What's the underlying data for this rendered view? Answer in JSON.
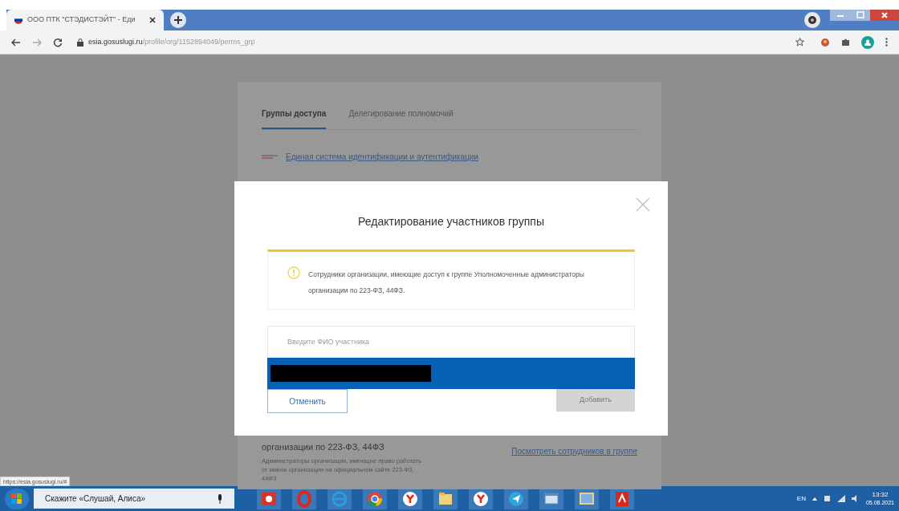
{
  "browser": {
    "tab_title": "ООО ПТК \"СТЭДИСТЭЙТ\" - Еди",
    "url_host": "esia.gosuslugi.ru",
    "url_path": "/profile/org/1152894049/perms_grp"
  },
  "page": {
    "tabs": [
      {
        "label": "Группы доступа",
        "selected": true
      },
      {
        "label": "Делегирование полномочий",
        "selected": false
      }
    ],
    "system_link": "Единая система идентификации и аутентификации",
    "group_title": "организации по 223-ФЗ, 44ФЗ",
    "group_description": "Администраторы организации, имеющие право работать от имени организации на официальном сайте 223-ФЗ, 44ФЗ",
    "view_link": "Посмотреть сотрудников в группе"
  },
  "modal": {
    "title": "Редактирование участников группы",
    "notice": "Сотрудники организации, имеющие доступ к группе Уполномоченные администраторы организации по 223-ФЗ, 44ФЗ.",
    "search": {
      "placeholder": "Введите ФИО участника"
    },
    "suggestions": [
      {
        "redacted": true,
        "selected": true
      }
    ],
    "buttons": [
      {
        "label": "Отменить",
        "disabled": false,
        "kind": "secondary"
      },
      {
        "label": "Добавить",
        "disabled": true,
        "kind": "primary"
      }
    ]
  },
  "status_url": "https://esia.gosuslugi.ru/#",
  "taskbar": {
    "search_placeholder": "Скажите «Слушай, Алиса»",
    "language": "EN",
    "time": "13:32",
    "date": "05.08.2021"
  }
}
